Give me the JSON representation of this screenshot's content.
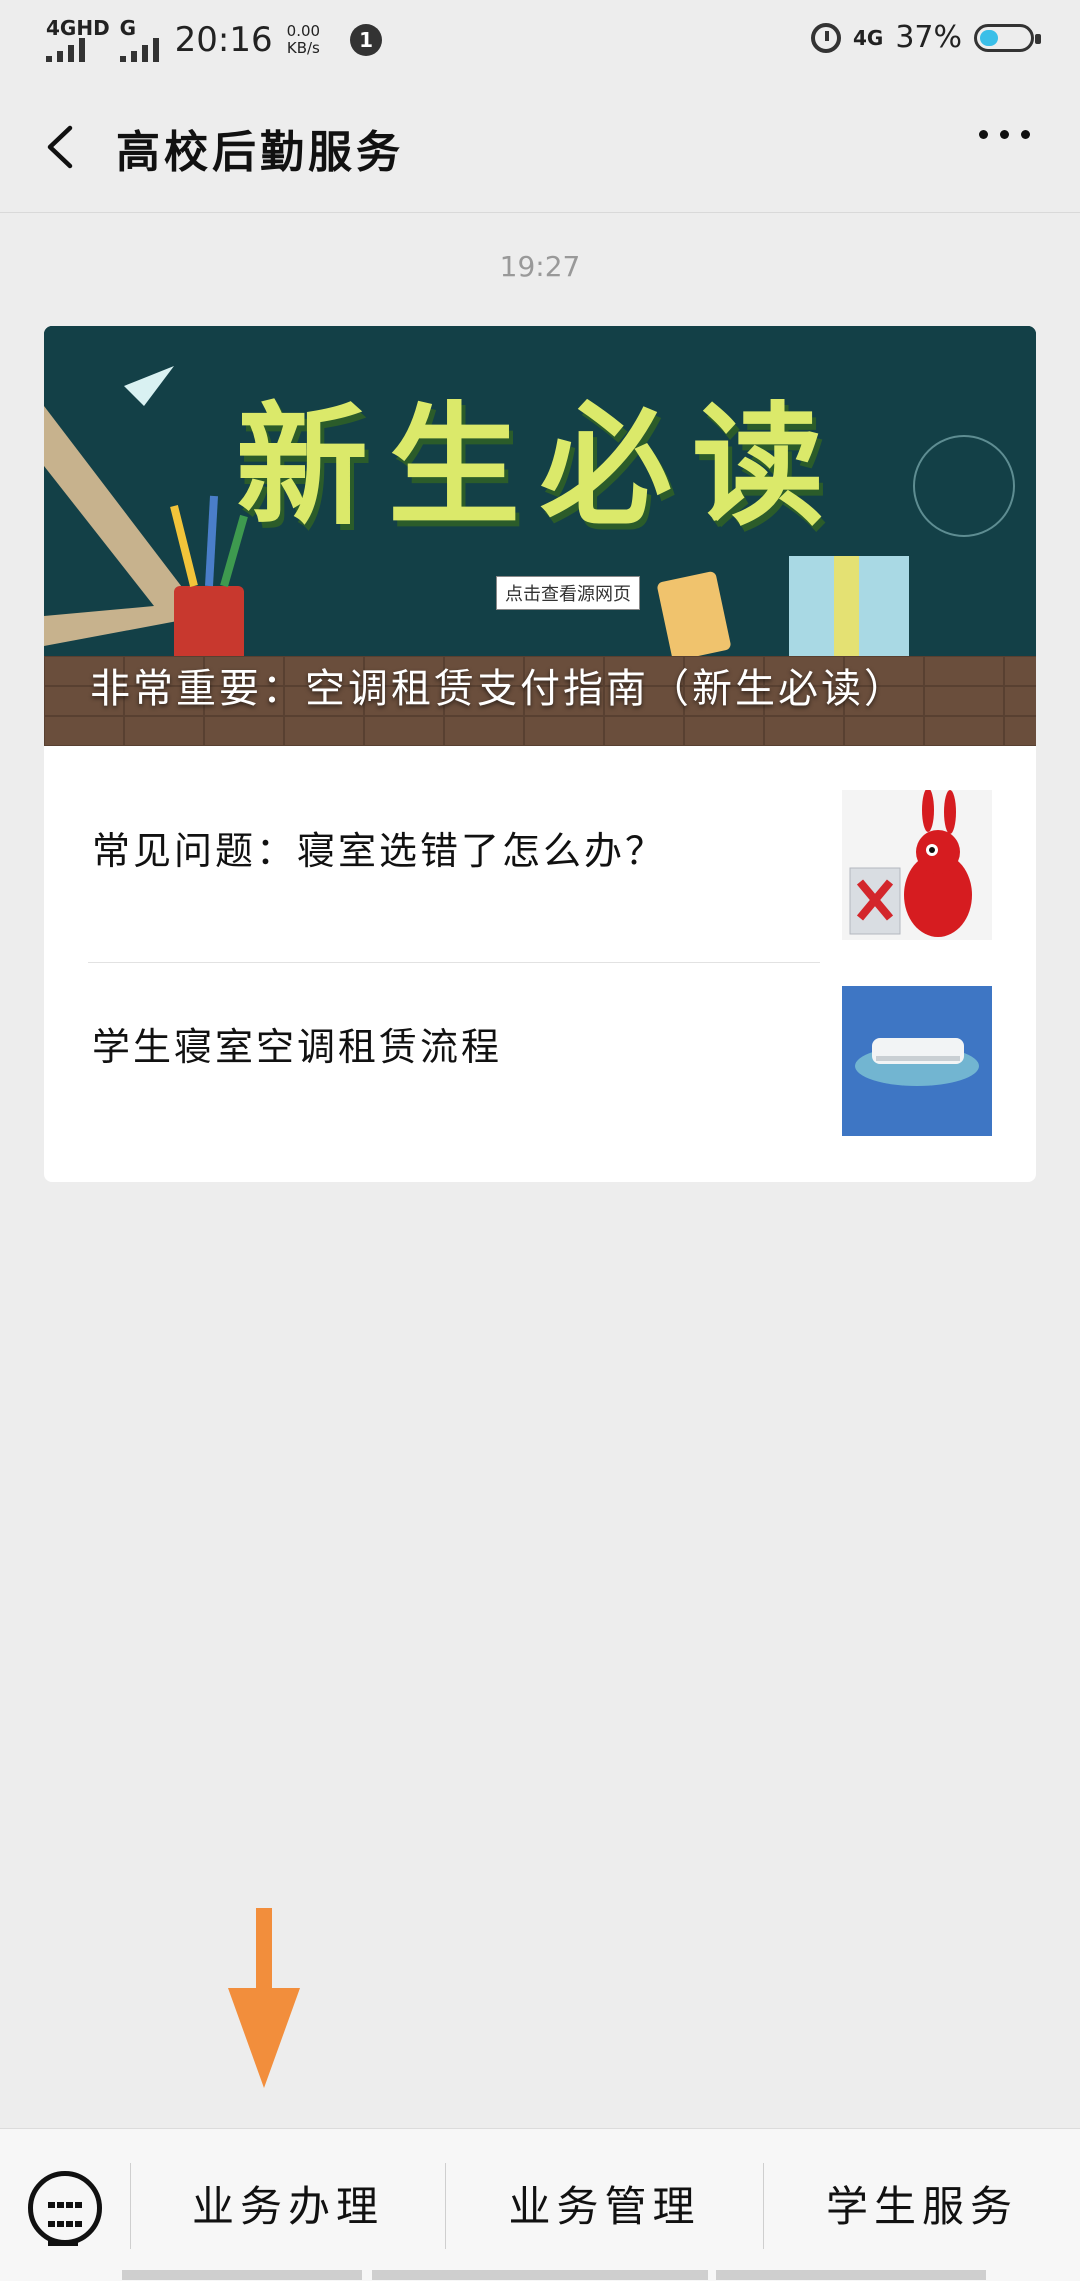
{
  "status_bar": {
    "network1": "4GHD",
    "network2": "G",
    "time": "20:16",
    "speed_value": "0.00",
    "speed_unit": "KB/s",
    "notification_count": "1",
    "network_right": "4G",
    "battery": "37%",
    "battery_level": 0.37,
    "icons": [
      "alarm-icon",
      "battery-icon"
    ]
  },
  "header": {
    "title": "高校后勤服务",
    "back_icon": "back-arrow-icon",
    "more_icon": "more-dots-icon"
  },
  "chat": {
    "timestamp": "19:27"
  },
  "article_card": {
    "banner_text": "新生必读",
    "banner_tag": "点击查看源网页",
    "main_title": "非常重要：空调租赁支付指南（新生必读）",
    "items": [
      {
        "title": "常见问题：寝室选错了怎么办？",
        "thumb_icon": "red-rabbit-image"
      },
      {
        "title": "学生寝室空调租赁流程",
        "thumb_icon": "air-conditioner-image"
      }
    ]
  },
  "bottom_menu": {
    "keyboard_icon": "keyboard-icon",
    "items": [
      "业务办理",
      "业务管理",
      "学生服务"
    ]
  },
  "colors": {
    "background": "#ededed",
    "arrow": "#f28e3c",
    "banner_bg": "#123f45",
    "banner_text": "#dbe96a"
  }
}
